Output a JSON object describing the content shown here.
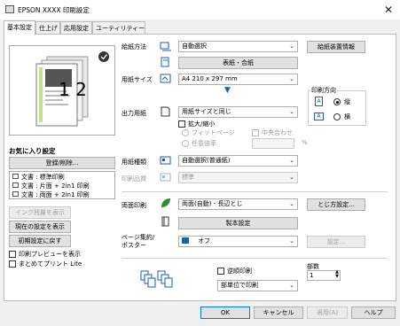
{
  "window": {
    "title": "EPSON XXXX 印刷設定",
    "close_label": "✕"
  },
  "tabs": [
    {
      "label": "基本設定",
      "active": true
    },
    {
      "label": "仕上げ",
      "active": false
    },
    {
      "label": "応用設定",
      "active": false
    },
    {
      "label": "ユーティリティー",
      "active": false
    }
  ],
  "left": {
    "preview_copies": "1 2",
    "favorites_title": "お気に入り設定",
    "register_button": "登録/削除...",
    "favorites": [
      "文書 : 標準印刷",
      "文書 : 片面 + 2in1 印刷",
      "文書 : 両面 + 2in1 印刷"
    ],
    "ink_button": "インク残量を表示",
    "current_settings_button": "現在の設定を表示",
    "reset_button": "初期設定に戻す",
    "print_preview_label": "印刷プレビューを表示",
    "lite_label": "まとめてプリント Lite"
  },
  "form": {
    "paper_source_label": "給紙方法",
    "paper_source_value": "自動選択",
    "tray_info_button": "給紙装置情報",
    "cover_button": "表紙・合紙",
    "paper_size_label": "用紙サイズ",
    "paper_size_value": "A4 210 x 297 mm",
    "orientation_title": "印刷方向",
    "orientation_portrait": "縦",
    "orientation_landscape": "横",
    "output_paper_label": "出力用紙",
    "output_paper_value": "用紙サイズと同じ",
    "scale_label": "拡大/縮小",
    "fit_page_label": "フィットページ",
    "center_label": "中央合わせ",
    "custom_scale_label": "任意倍率",
    "percent_unit": "%",
    "paper_type_label": "用紙種類",
    "paper_type_value": "自動選択(普通紙)",
    "quality_label": "印刷品質",
    "quality_value": "標準",
    "duplex_label": "両面印刷",
    "duplex_value": "両面(自動) - 長辺とじ",
    "binding_button": "とじ方設定...",
    "booklet_button": "製本設定",
    "multipage_label": "ページ集約/\nポスター",
    "multipage_value": "オフ",
    "multipage_settings_button": "設定...",
    "reverse_label": "逆順印刷",
    "copies_label": "部数",
    "copies_value": "1",
    "collate_value": "部単位で印刷"
  },
  "footer": {
    "ok": "OK",
    "cancel": "キャンセル",
    "apply": "適用(A)",
    "help": "ヘルプ"
  },
  "colors": {
    "accent_blue": "#1a5fb4",
    "green": "#2e8b2e",
    "dark": "#333333"
  }
}
